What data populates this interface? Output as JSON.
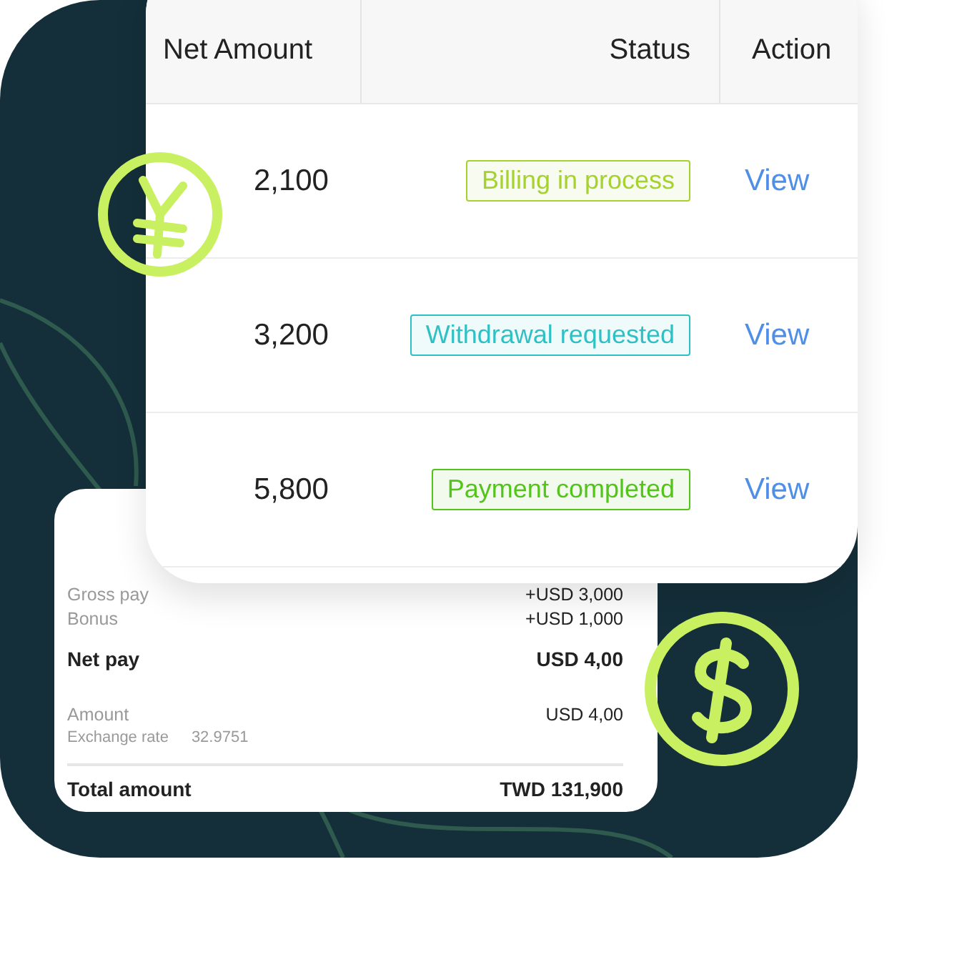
{
  "table": {
    "columns": [
      "Net Amount",
      "Status",
      "Action"
    ],
    "rows": [
      {
        "net_amount": "2,100",
        "status": "Billing in process",
        "color": "#a6d22e",
        "action": "View"
      },
      {
        "net_amount": "3,200",
        "status": "Withdrawal requested",
        "color": "#2fc0c4",
        "action": "View"
      },
      {
        "net_amount": "5,800",
        "status": "Payment completed",
        "color": "#52c41a",
        "action": "View"
      }
    ]
  },
  "receipt": {
    "lines": [
      {
        "kind": "item",
        "label": "Gross pay",
        "value": "+USD 3,000"
      },
      {
        "kind": "item",
        "label": "Bonus",
        "value": "+USD 1,000"
      },
      {
        "kind": "subtotal",
        "label": "Net pay",
        "value": "USD 4,00"
      },
      {
        "kind": "item",
        "label": "Amount",
        "value": "USD 4,00"
      },
      {
        "kind": "rate",
        "label": "Exchange rate",
        "value": "32.9751"
      },
      {
        "kind": "total",
        "label": "Total amount",
        "value": "TWD 131,900"
      }
    ]
  }
}
